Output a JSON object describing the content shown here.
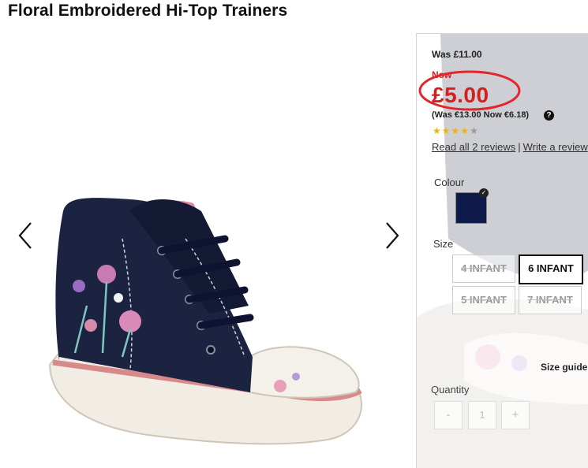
{
  "product": {
    "title": "Floral Embroidered Hi-Top Trainers"
  },
  "gallery": {
    "prev_icon": "chevron-left-icon",
    "next_icon": "chevron-right-icon"
  },
  "pricing": {
    "was": "Was £11.00",
    "now_label": "Now",
    "now_price": "£5.00",
    "euro": "(Was €13.00 Now €6.18)",
    "help_glyph": "?",
    "highlight_color": "#e3262b"
  },
  "rating": {
    "stars": 3.5,
    "out_of": 5,
    "read_reviews": "Read all 2 reviews",
    "separator": "|",
    "write_review": "Write a review"
  },
  "colour": {
    "label": "Colour",
    "selected_swatch": "#0e1a4a"
  },
  "size": {
    "label": "Size",
    "options": [
      {
        "label": "4 INFANT",
        "available": false,
        "selected": false
      },
      {
        "label": "6 INFANT",
        "available": true,
        "selected": true
      },
      {
        "label": "5 INFANT",
        "available": false,
        "selected": false
      },
      {
        "label": "7 INFANT",
        "available": false,
        "selected": false
      }
    ],
    "guide": "Size guide"
  },
  "quantity": {
    "label": "Quantity",
    "minus": "-",
    "value": "1",
    "plus": "+"
  }
}
